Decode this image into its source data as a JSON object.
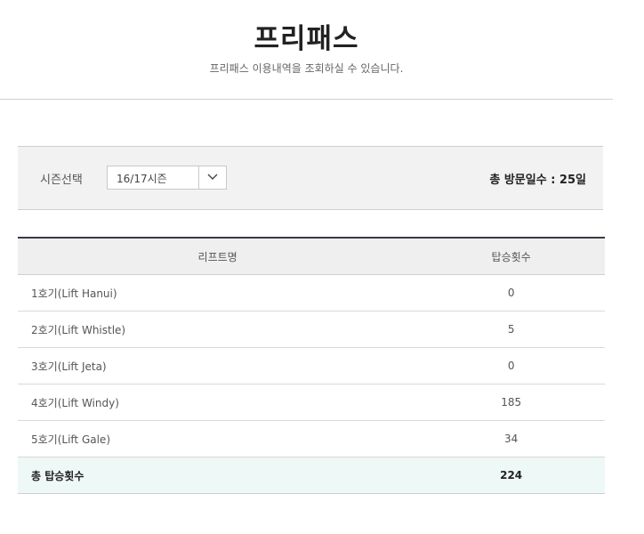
{
  "header": {
    "title": "프리패스",
    "subtitle": "프리패스 이용내역을 조회하실 수 있습니다."
  },
  "filter": {
    "season_label": "시즌선택",
    "season_selected": "16/17시즌",
    "visit_total_label": "총 방문일수 : 25일"
  },
  "table": {
    "headers": [
      "리프트명",
      "탑승횟수"
    ],
    "rows": [
      {
        "name": "1호기(Lift Hanui)",
        "count": "0"
      },
      {
        "name": "2호기(Lift Whistle)",
        "count": "5"
      },
      {
        "name": "3호기(Lift Jeta)",
        "count": "0"
      },
      {
        "name": "4호기(Lift Windy)",
        "count": "185"
      },
      {
        "name": "5호기(Lift Gale)",
        "count": "34"
      }
    ],
    "total": {
      "label": "총 탑승횟수",
      "count": "224"
    }
  },
  "icons": {
    "select_arrow": "chevron-down-icon"
  },
  "colors": {
    "table_top_border": "#3a3a44",
    "total_row_bg": "#eef8f6",
    "filter_bg": "#f2f2f2"
  }
}
